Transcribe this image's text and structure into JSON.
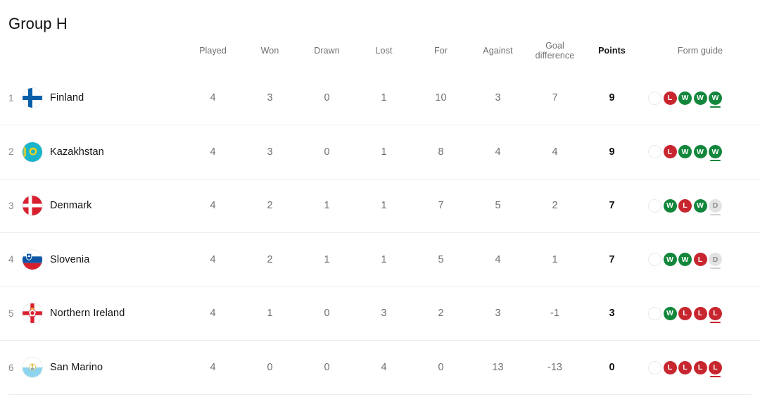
{
  "title": "Group H",
  "columns": {
    "team": "",
    "played": "Played",
    "won": "Won",
    "drawn": "Drawn",
    "lost": "Lost",
    "for": "For",
    "against": "Against",
    "goal_difference_line1": "Goal",
    "goal_difference_line2": "difference",
    "points": "Points",
    "form_guide": "Form guide"
  },
  "colors": {
    "win": "#12873c",
    "loss": "#c7262f",
    "draw": "#e3e3e3",
    "text_primary": "#121212",
    "text_secondary": "#6f6f6f",
    "row_divider": "#ededed"
  },
  "rows": [
    {
      "position": "1",
      "team": "Finland",
      "flag": "flag-finland",
      "played": "4",
      "won": "3",
      "drawn": "0",
      "lost": "1",
      "for": "10",
      "against": "3",
      "goal_difference": "7",
      "points": "9",
      "form": [
        "",
        "L",
        "W",
        "W",
        "W"
      ]
    },
    {
      "position": "2",
      "team": "Kazakhstan",
      "flag": "flag-kazakhstan",
      "played": "4",
      "won": "3",
      "drawn": "0",
      "lost": "1",
      "for": "8",
      "against": "4",
      "goal_difference": "4",
      "points": "9",
      "form": [
        "",
        "L",
        "W",
        "W",
        "W"
      ]
    },
    {
      "position": "3",
      "team": "Denmark",
      "flag": "flag-denmark",
      "played": "4",
      "won": "2",
      "drawn": "1",
      "lost": "1",
      "for": "7",
      "against": "5",
      "goal_difference": "2",
      "points": "7",
      "form": [
        "",
        "W",
        "L",
        "W",
        "D"
      ]
    },
    {
      "position": "4",
      "team": "Slovenia",
      "flag": "flag-slovenia",
      "played": "4",
      "won": "2",
      "drawn": "1",
      "lost": "1",
      "for": "5",
      "against": "4",
      "goal_difference": "1",
      "points": "7",
      "form": [
        "",
        "W",
        "W",
        "L",
        "D"
      ]
    },
    {
      "position": "5",
      "team": "Northern Ireland",
      "flag": "flag-northern-ireland",
      "played": "4",
      "won": "1",
      "drawn": "0",
      "lost": "3",
      "for": "2",
      "against": "3",
      "goal_difference": "-1",
      "points": "3",
      "form": [
        "",
        "W",
        "L",
        "L",
        "L"
      ]
    },
    {
      "position": "6",
      "team": "San Marino",
      "flag": "flag-san-marino",
      "played": "4",
      "won": "0",
      "drawn": "0",
      "lost": "4",
      "for": "0",
      "against": "13",
      "goal_difference": "-13",
      "points": "0",
      "form": [
        "",
        "L",
        "L",
        "L",
        "L"
      ]
    }
  ]
}
